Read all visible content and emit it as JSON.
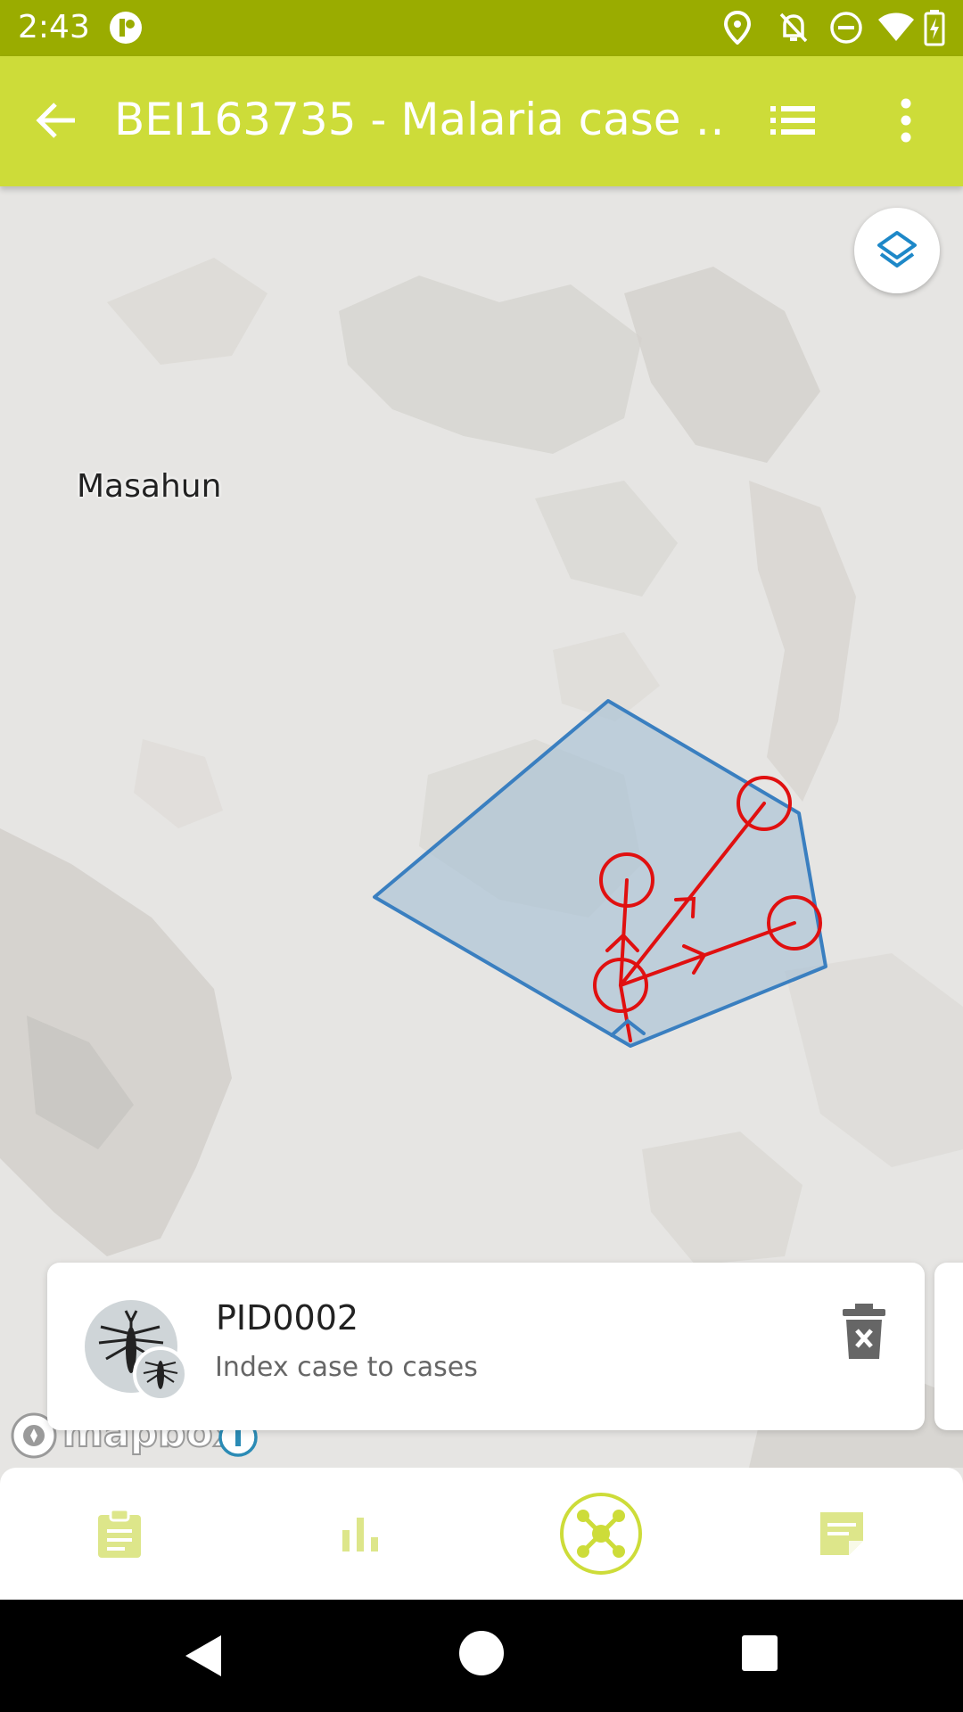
{
  "status_bar": {
    "time": "2:43",
    "icons": [
      "app-notification-icon",
      "location-icon",
      "notifications-off-icon",
      "do-not-disturb-icon",
      "wifi-icon",
      "battery-charging-icon"
    ]
  },
  "app_bar": {
    "title": "BEI163735  - Malaria case …",
    "icons": [
      "back-arrow-icon",
      "list-icon",
      "more-vert-icon"
    ]
  },
  "map": {
    "place_label": "Masahun",
    "attribution": "mapbox",
    "colors": {
      "polygon_fill": "#a9c1d6",
      "polygon_stroke": "#3a7fc0",
      "relation_lines": "#e01010"
    }
  },
  "card": {
    "title": "PID0002",
    "subtitle": "Index case to cases",
    "icons": [
      "mosquito-avatar-icon",
      "delete-icon"
    ]
  },
  "bottom_nav": {
    "items": [
      {
        "icon": "clipboard-icon",
        "active": false
      },
      {
        "icon": "bar-chart-icon",
        "active": false
      },
      {
        "icon": "relationship-map-icon",
        "active": true
      },
      {
        "icon": "notes-icon",
        "active": false
      }
    ],
    "accent": "#cddc39"
  }
}
